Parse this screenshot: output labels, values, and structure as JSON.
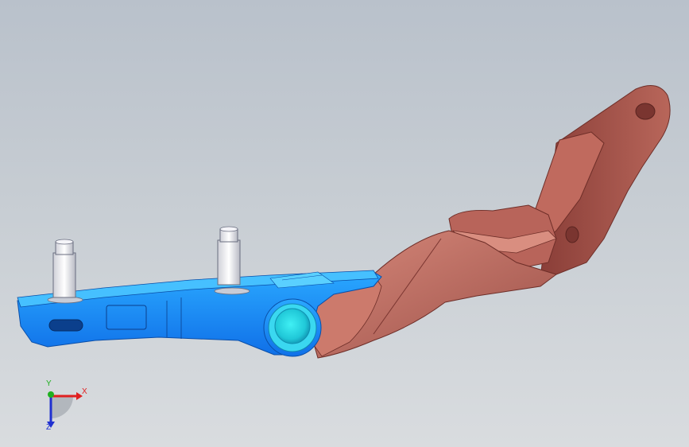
{
  "viewport": {
    "background_top": "#b9c1cb",
    "background_bottom": "#d9dcdf"
  },
  "model": {
    "parts": [
      {
        "name": "hinge-bracket-body",
        "color": "#1e8fff"
      },
      {
        "name": "hinge-arm",
        "color": "#c8766a"
      },
      {
        "name": "mounting-stud-1",
        "color": "#e8e8ec"
      },
      {
        "name": "mounting-stud-2",
        "color": "#e8e8ec"
      },
      {
        "name": "pivot-bushing",
        "color": "#2fe0e8"
      }
    ]
  },
  "triad": {
    "x_label": "X",
    "y_label": "Y",
    "z_label": "Z",
    "x_color": "#e02020",
    "y_color": "#20b020",
    "z_color": "#2030d0"
  }
}
